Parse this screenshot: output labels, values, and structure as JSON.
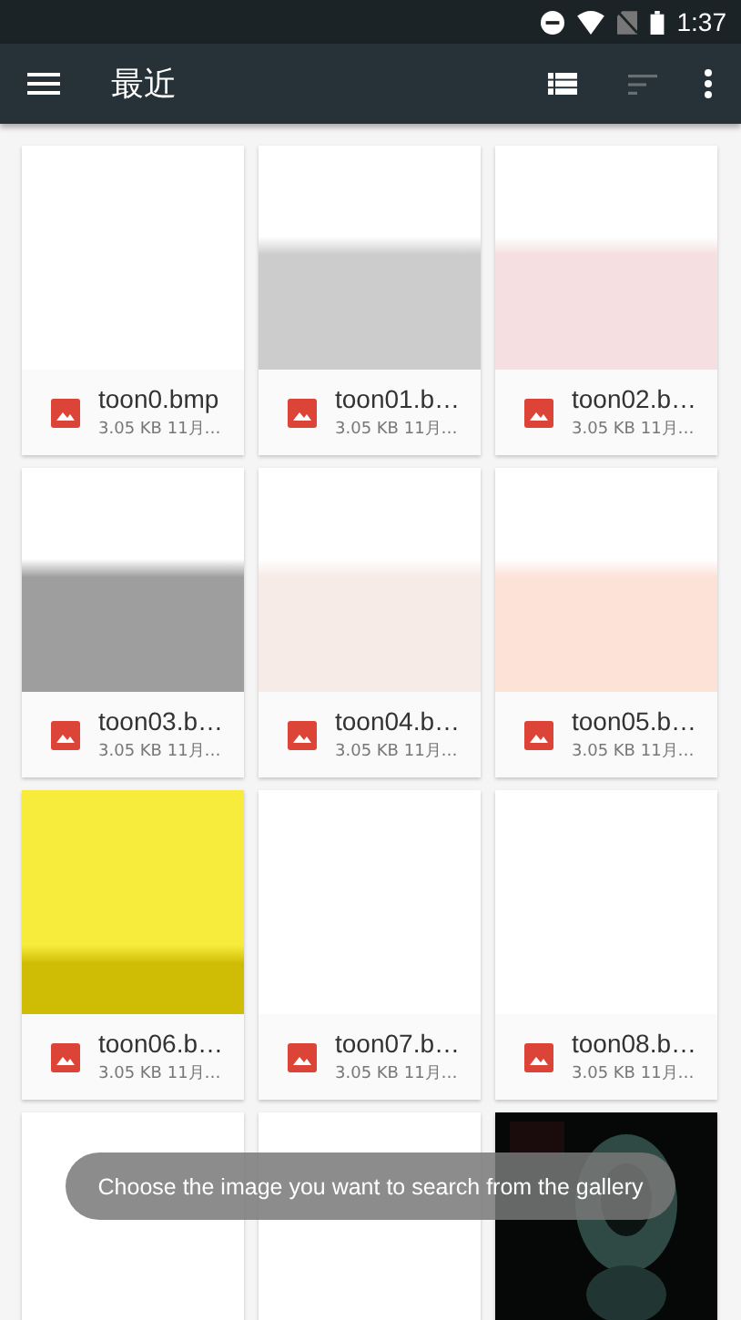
{
  "status_bar": {
    "time": "1:37"
  },
  "toolbar": {
    "title": "最近",
    "actions": [
      {
        "kind": "list_view",
        "disabled": false
      },
      {
        "kind": "sort",
        "disabled": true
      },
      {
        "kind": "more",
        "disabled": false
      }
    ]
  },
  "files": [
    {
      "kind": "file",
      "name": "toon0.bmp",
      "meta": "3.05 KB 11月…"
    },
    {
      "kind": "file",
      "name": "toon01.b…",
      "meta": "3.05 KB 11月…"
    },
    {
      "kind": "file",
      "name": "toon02.b…",
      "meta": "3.05 KB 11月…"
    },
    {
      "kind": "file",
      "name": "toon03.b…",
      "meta": "3.05 KB 11月…"
    },
    {
      "kind": "file",
      "name": "toon04.b…",
      "meta": "3.05 KB 11月…"
    },
    {
      "kind": "file",
      "name": "toon05.b…",
      "meta": "3.05 KB 11月…"
    },
    {
      "kind": "file",
      "name": "toon06.b…",
      "meta": "3.05 KB 11月…"
    },
    {
      "kind": "file",
      "name": "toon07.b…",
      "meta": "3.05 KB 11月…"
    },
    {
      "kind": "file",
      "name": "toon08.b…",
      "meta": "3.05 KB 11月…"
    },
    {
      "kind": "preview"
    },
    {
      "kind": "preview"
    },
    {
      "kind": "preview"
    }
  ],
  "toast": "Choose the image you want to search from the gallery"
}
